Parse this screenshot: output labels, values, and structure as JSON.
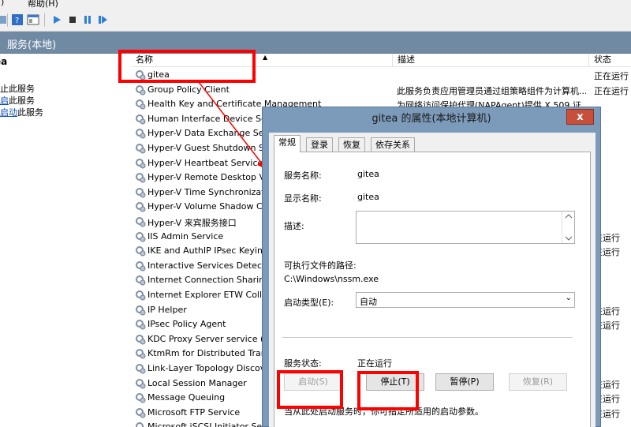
{
  "menubar": {
    "view_fragment": ")",
    "help": "帮助(H)"
  },
  "toolbar": {
    "icons": [
      "nav-back-icon",
      "help-book-icon",
      "properties-pane-icon",
      "play-icon",
      "stop-icon",
      "pause-icon",
      "restart-icon"
    ]
  },
  "console": {
    "title": "服务(本地)"
  },
  "leftpane": {
    "selected_name": "ea",
    "links": [
      {
        "prefix": "",
        "link": "",
        "suffix": "止此服务"
      },
      {
        "prefix": "",
        "link": "启",
        "suffix": "此服务"
      },
      {
        "prefix": "",
        "link": "启动",
        "suffix": "此服务"
      }
    ]
  },
  "list": {
    "columns": [
      "名称",
      "描述",
      "状态"
    ],
    "rows": [
      {
        "name": "gitea",
        "desc": "",
        "state": "正在运行"
      },
      {
        "name": "Group Policy Client",
        "desc": "此服务负责应用管理员通过组策略组件为计算机...",
        "state": "正在运行"
      },
      {
        "name": "Health Key and Certificate Management",
        "desc": "为网络访问保护代理(NAPAgent)提供 X.509 证...",
        "state": ""
      },
      {
        "name": "Human Interface Device Ser",
        "desc": "",
        "state": ""
      },
      {
        "name": "Hyper-V Data Exchange Ser",
        "desc": "",
        "state": ""
      },
      {
        "name": "Hyper-V Guest Shutdown Se",
        "desc": "",
        "state": ""
      },
      {
        "name": "Hyper-V Heartbeat Service",
        "desc": "",
        "state": ""
      },
      {
        "name": "Hyper-V Remote Desktop V",
        "desc": "",
        "state": ""
      },
      {
        "name": "Hyper-V Time Synchronizati",
        "desc": "",
        "state": ""
      },
      {
        "name": "Hyper-V Volume Shadow Co",
        "desc": "",
        "state": ""
      },
      {
        "name": "Hyper-V 来宾服务接口",
        "desc": "",
        "state": ""
      },
      {
        "name": "IIS Admin Service",
        "desc": "",
        "state": "在运行"
      },
      {
        "name": "IKE and AuthIP IPsec Keying",
        "desc": "",
        "state": "在运行"
      },
      {
        "name": "Interactive Services Detectio",
        "desc": "",
        "state": ""
      },
      {
        "name": "Internet Connection Sharing",
        "desc": "",
        "state": ""
      },
      {
        "name": "Internet Explorer ETW Colle",
        "desc": "",
        "state": ""
      },
      {
        "name": "IP Helper",
        "desc": "",
        "state": "在运行"
      },
      {
        "name": "IPsec Policy Agent",
        "desc": "",
        "state": "在运行"
      },
      {
        "name": "KDC Proxy Server service (K",
        "desc": "",
        "state": ""
      },
      {
        "name": "KtmRm for Distributed Tran",
        "desc": "",
        "state": ""
      },
      {
        "name": "Link-Layer Topology Discov",
        "desc": "",
        "state": ""
      },
      {
        "name": "Local Session Manager",
        "desc": "",
        "state": "在运行"
      },
      {
        "name": "Message Queuing",
        "desc": "",
        "state": "在运行"
      },
      {
        "name": "Microsoft FTP Service",
        "desc": "",
        "state": "在运行"
      },
      {
        "name": "Microsoft iSCSI Initiator Se",
        "desc": "",
        "state": ""
      }
    ]
  },
  "dialog": {
    "title": "gitea 的属性(本地计算机)",
    "close_glyph": "x",
    "tabs": [
      "常规",
      "登录",
      "恢复",
      "依存关系"
    ],
    "service_name_label": "服务名称:",
    "service_name_value": "gitea",
    "display_name_label": "显示名称:",
    "display_name_value": "gitea",
    "description_label": "描述:",
    "exe_path_label": "可执行文件的路径:",
    "exe_path_value": "C:\\Windows\\nssm.exe",
    "startup_type_label": "启动类型(E):",
    "startup_type_value": "自动",
    "status_label": "服务状态:",
    "status_value": "正在运行",
    "buttons": {
      "start": "启动(S)",
      "stop": "停止(T)",
      "pause": "暂停(P)",
      "resume": "恢复(R)"
    },
    "hint": "当从此处启动服务时，你可指定所适用的启动参数。"
  },
  "colors": {
    "annotation_red": "#ff0000",
    "header_blue": "#708aa4",
    "dialog_frame": "#7c9ab9",
    "close_red": "#c7503d",
    "link_blue": "#0b4bbf"
  }
}
